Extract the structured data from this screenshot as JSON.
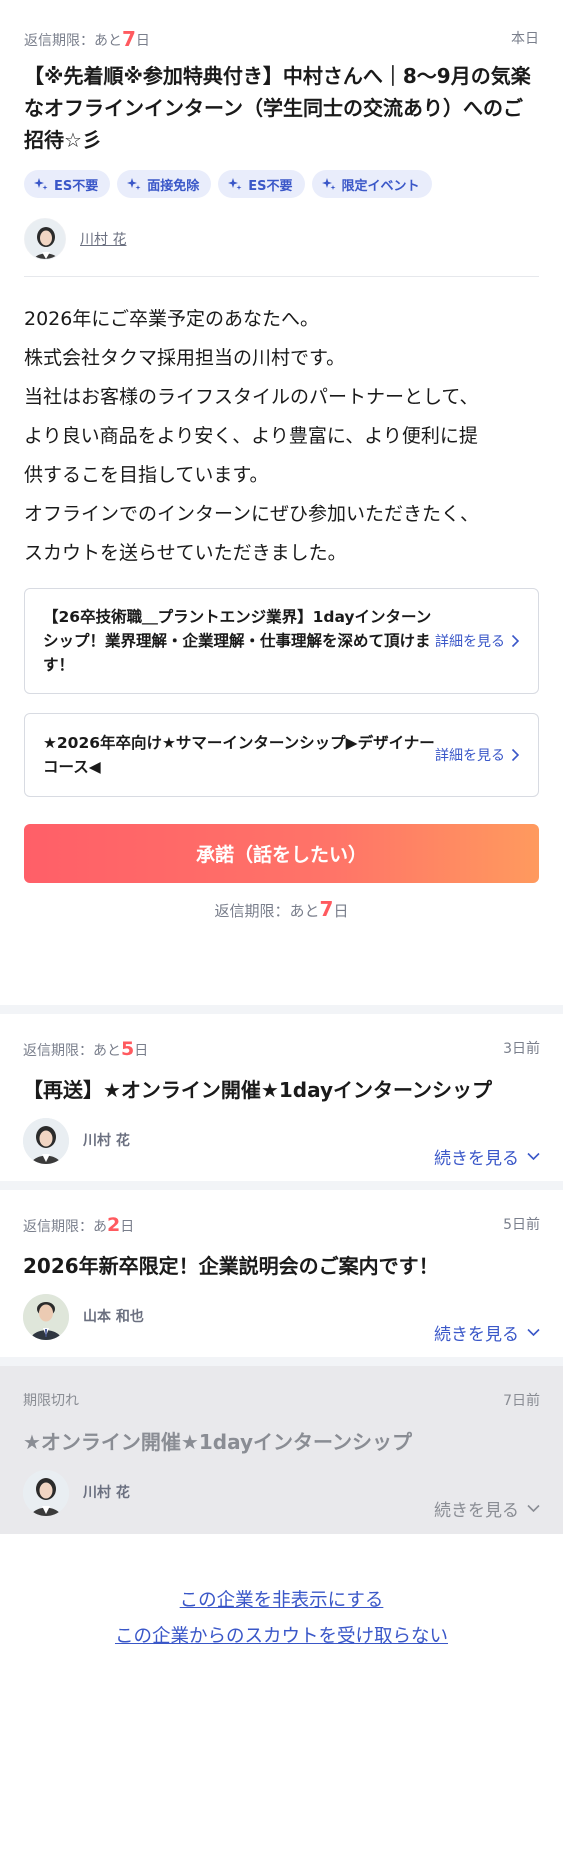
{
  "main": {
    "deadline_prefix": "返信期限：あと",
    "deadline_num": "7",
    "deadline_suffix": "日",
    "date": "本日",
    "title": "【※先着順※参加特典付き】中村さんへ｜8〜9月の気楽なオフラインインターン（学生同士の交流あり）へのご招待☆彡",
    "tags": [
      "ES不要",
      "面接免除",
      "ES不要",
      "限定イベント"
    ],
    "sender_name": "川村 花",
    "body_lines": [
      "2026年にご卒業予定のあなたへ。",
      "株式会社タクマ採用担当の川村です。",
      "当社はお客様のライフスタイルのパートナーとして、",
      "より良い商品をより安く、より豊富に、より便利に提",
      "供するこを目指しています。",
      "オフラインでのインターンにぜひ参加いただきたく、",
      "スカウトを送らせていただきました。"
    ],
    "links": [
      {
        "text": "【26卒技術職＿プラントエンジ業界】1dayインターンシップ！業界理解・企業理解・仕事理解を深めて頂けます！",
        "more": "詳細を見る"
      },
      {
        "text": "★2026年卒向け★サマーインターンシップ▶デザイナーコース◀",
        "more": "詳細を見る"
      }
    ],
    "accept_label": "承諾（話をしたい）",
    "bottom_deadline_prefix": "返信期限：あと",
    "bottom_deadline_num": "7",
    "bottom_deadline_suffix": "日"
  },
  "messages": [
    {
      "deadline_prefix": "返信期限：あと",
      "deadline_num": "5",
      "deadline_suffix": "日",
      "date": "3日前",
      "title": "【再送】★オンライン開催★1dayインターンシップ",
      "sender": "川村 花",
      "more": "続きを見る"
    },
    {
      "deadline_prefix": "返信期限：あ",
      "deadline_num": "2",
      "deadline_suffix": "日",
      "date": "5日前",
      "title": "2026年新卒限定！企業説明会のご案内です！",
      "sender": "山本 和也",
      "more": "続きを見る"
    },
    {
      "status": "期限切れ",
      "date": "7日前",
      "title": "★オンライン開催★1dayインターンシップ",
      "sender": "川村 花",
      "more": "続きを見る"
    }
  ],
  "footer": {
    "hide_company": "この企業を非表示にする",
    "block_scouts": "この企業からのスカウトを受け取らない"
  },
  "colors": {
    "accent": "#3a57c8",
    "deadline_red": "#ff5a5f",
    "button_gradient_start": "#ff5f68",
    "button_gradient_end": "#ff9a5e"
  }
}
